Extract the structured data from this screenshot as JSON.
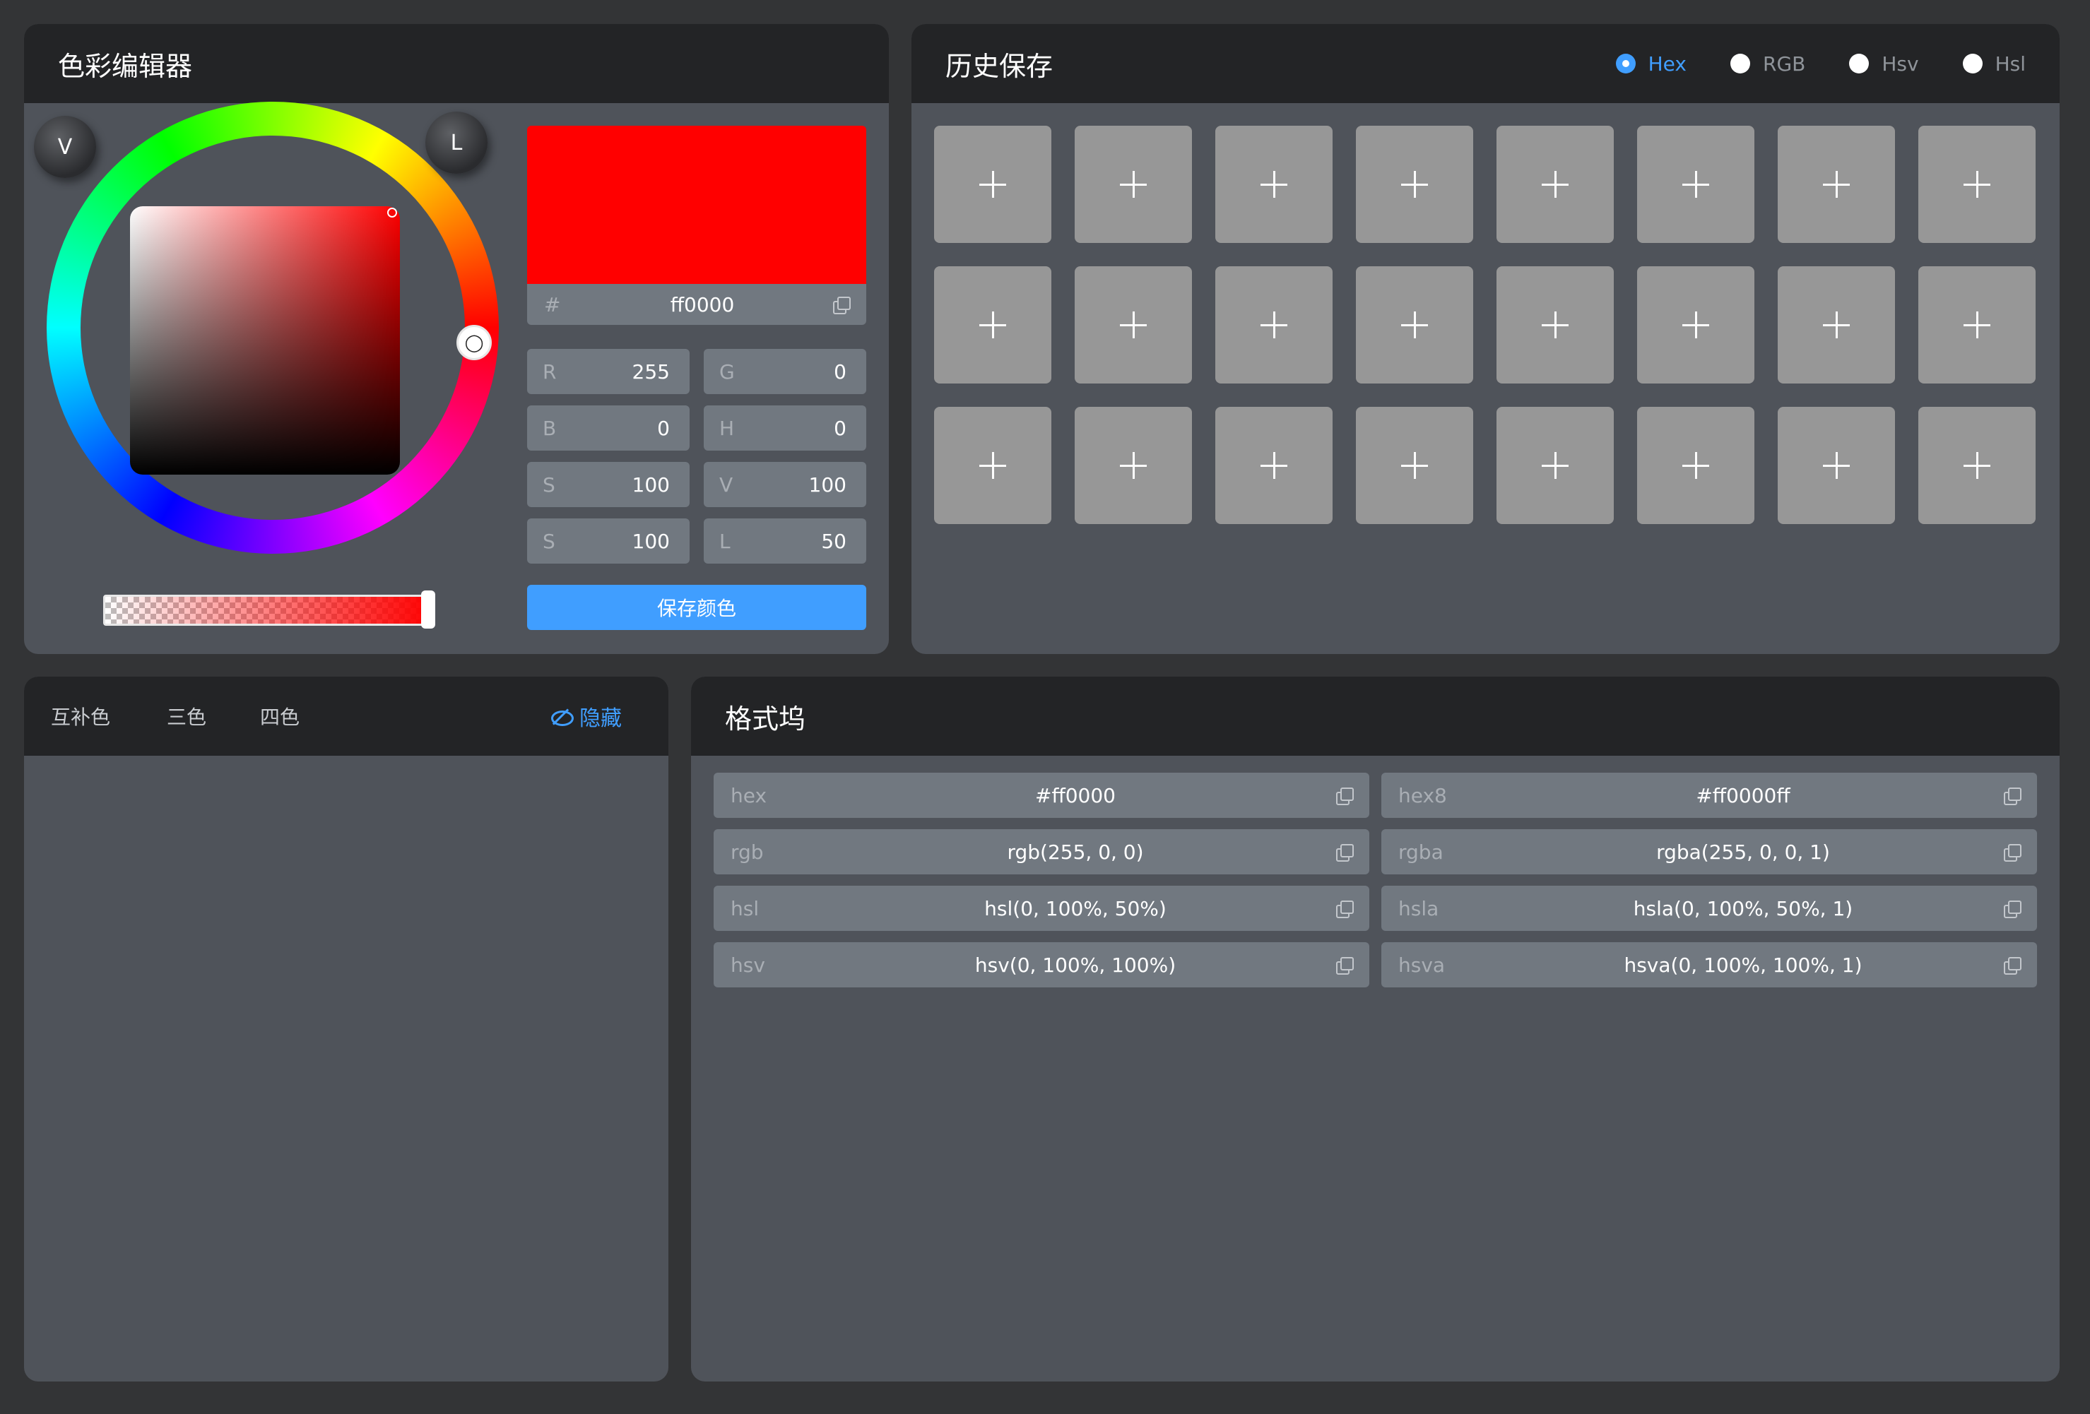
{
  "editor": {
    "title": "色彩编辑器",
    "mode_v": "V",
    "mode_l": "L",
    "hex_prefix": "#",
    "hex_value": "ff0000",
    "preview_color": "#ff0000",
    "channels": [
      {
        "label": "R",
        "value": "255"
      },
      {
        "label": "G",
        "value": "0"
      },
      {
        "label": "B",
        "value": "0"
      },
      {
        "label": "H",
        "value": "0"
      },
      {
        "label": "S",
        "value": "100"
      },
      {
        "label": "V",
        "value": "100"
      },
      {
        "label": "S",
        "value": "100"
      },
      {
        "label": "L",
        "value": "50"
      }
    ],
    "save_label": "保存颜色"
  },
  "history": {
    "title": "历史保存",
    "formats": [
      {
        "label": "Hex",
        "selected": true
      },
      {
        "label": "RGB",
        "selected": false
      },
      {
        "label": "Hsv",
        "selected": false
      },
      {
        "label": "Hsl",
        "selected": false
      }
    ],
    "slot_icon": "plus-icon",
    "slot_count": 24
  },
  "harmony": {
    "tabs": [
      "互补色",
      "三色",
      "四色"
    ],
    "hide_label": "隐藏"
  },
  "formats": {
    "title": "格式坞",
    "rows": [
      {
        "name": "hex",
        "value": "#ff0000"
      },
      {
        "name": "hex8",
        "value": "#ff0000ff"
      },
      {
        "name": "rgb",
        "value": "rgb(255, 0, 0)"
      },
      {
        "name": "rgba",
        "value": "rgba(255, 0, 0, 1)"
      },
      {
        "name": "hsl",
        "value": "hsl(0, 100%, 50%)"
      },
      {
        "name": "hsla",
        "value": "hsla(0, 100%, 50%, 1)"
      },
      {
        "name": "hsv",
        "value": "hsv(0, 100%, 100%)"
      },
      {
        "name": "hsva",
        "value": "hsva(0, 100%, 100%, 1)"
      }
    ]
  },
  "colors": {
    "accent": "#409eff",
    "panel_bg": "#4f535a",
    "header_bg": "#232426",
    "field_bg": "#717880",
    "swatch_bg": "#979797"
  }
}
